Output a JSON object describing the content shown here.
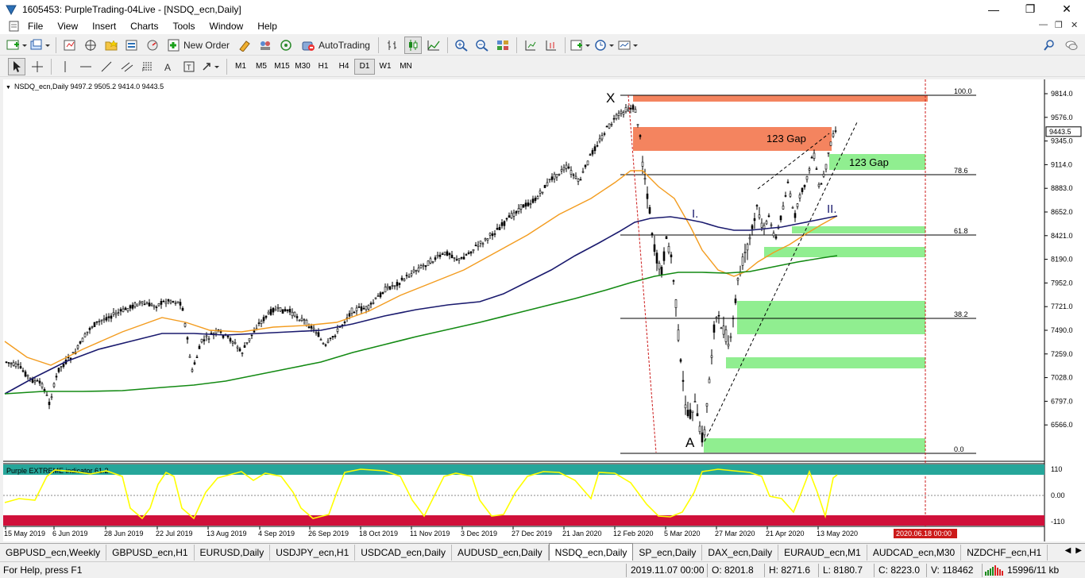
{
  "window": {
    "title": "1605453: PurpleTrading-04Live - [NSDQ_ecn,Daily]",
    "minimize": "—",
    "restore": "❐",
    "close": "✕"
  },
  "menu": {
    "items": [
      "File",
      "View",
      "Insert",
      "Charts",
      "Tools",
      "Window",
      "Help"
    ]
  },
  "toolbar": {
    "new_order_label": "New Order",
    "autotrading_label": "AutoTrading"
  },
  "timeframes": {
    "items": [
      "M1",
      "M5",
      "M15",
      "M30",
      "H1",
      "H4",
      "D1",
      "W1",
      "MN"
    ],
    "active": "D1"
  },
  "chart": {
    "symbol_header": "NSDQ_ecn,Daily  9497.2 9505.2 9414.0 9443.5",
    "current_price": "9443.5",
    "price_ticks": [
      "9814.0",
      "9576.0",
      "9345.0",
      "9114.0",
      "8883.0",
      "8652.0",
      "8421.0",
      "8190.0",
      "7952.0",
      "7721.0",
      "7490.0",
      "7259.0",
      "7028.0",
      "6797.0",
      "6566.0"
    ],
    "date_ticks": [
      "15 May 2019",
      "6 Jun 2019",
      "28 Jun 2019",
      "22 Jul 2019",
      "13 Aug 2019",
      "4 Sep 2019",
      "26 Sep 2019",
      "18 Oct 2019",
      "11 Nov 2019",
      "3 Dec 2019",
      "27 Dec 2019",
      "21 Jan 2020",
      "12 Feb 2020",
      "5 Mar 2020",
      "27 Mar 2020",
      "21 Apr 2020",
      "13 May 2020"
    ],
    "future_date_label": "2020.06.18 00:00",
    "fib_levels": [
      "100.0",
      "78.6",
      "61.8",
      "38.2",
      "0.0"
    ],
    "annotations": {
      "x_label": "X",
      "a_label": "A",
      "wave1_label": "I.",
      "wave2_label": "II.",
      "gap_upper_label": "123 Gap",
      "gap_lower_label": "123 Gap"
    },
    "colors": {
      "ma_fast": "#f39c1f",
      "ma_mid": "#1a1a6e",
      "ma_slow": "#138a13",
      "zone_green": "#90ee90",
      "zone_orange": "#f4845f",
      "indicator_line": "#ffff00"
    }
  },
  "indicator": {
    "label": "Purple EXTREME indicator 61.2",
    "ticks": [
      "110",
      "0.00",
      "-110"
    ]
  },
  "tabs": {
    "items": [
      "GBPUSD_ecn,Weekly",
      "GBPUSD_ecn,H1",
      "EURUSD,Daily",
      "USDJPY_ecn,H1",
      "USDCAD_ecn,Daily",
      "AUDUSD_ecn,Daily",
      "NSDQ_ecn,Daily",
      "SP_ecn,Daily",
      "DAX_ecn,Daily",
      "EURAUD_ecn,M1",
      "AUDCAD_ecn,M30",
      "NZDCHF_ecn,H1"
    ],
    "active": "NSDQ_ecn,Daily"
  },
  "status": {
    "help": "For Help, press F1",
    "datetime": "2019.11.07 00:00",
    "open": "O: 8201.8",
    "high": "H: 8271.6",
    "low": "L: 8180.7",
    "close": "C: 8223.0",
    "volume": "V: 118462",
    "traffic": "15996/11 kb"
  }
}
